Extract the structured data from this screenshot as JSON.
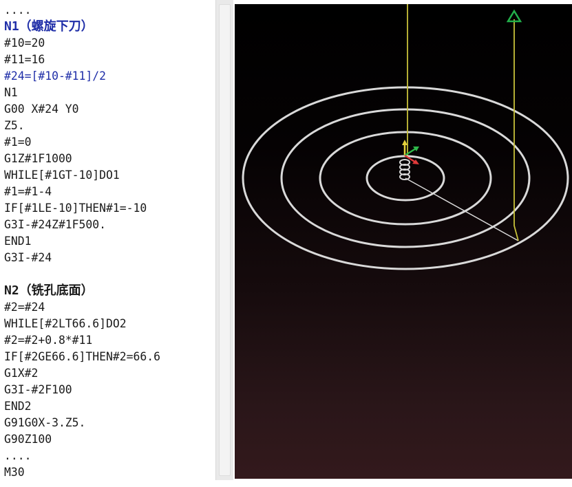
{
  "editor": {
    "lines": [
      {
        "text": "....",
        "style": "code"
      },
      {
        "text": "N1（螺旋下刀）",
        "style": "comment"
      },
      {
        "text": "#10=20",
        "style": "code"
      },
      {
        "text": "#11=16",
        "style": "code"
      },
      {
        "text": "#24=[#10-#11]/2",
        "style": "code"
      },
      {
        "text": "N1",
        "style": "code"
      },
      {
        "text": "G00 X#24 Y0",
        "style": "code"
      },
      {
        "text": "Z5.",
        "style": "code"
      },
      {
        "text": "#1=0",
        "style": "code"
      },
      {
        "text": "G1Z#1F1000",
        "style": "code"
      },
      {
        "text": "WHILE[#1GT-10]DO1",
        "style": "code"
      },
      {
        "text": "#1=#1-4",
        "style": "code"
      },
      {
        "text": "IF[#1LE-10]THEN#1=-10",
        "style": "code"
      },
      {
        "text": "G3I-#24Z#1F500.",
        "style": "code"
      },
      {
        "text": "END1",
        "style": "code"
      },
      {
        "text": "G3I-#24",
        "style": "code"
      },
      {
        "text": "",
        "style": "blank"
      },
      {
        "text": "N2（铣孔底面）",
        "style": "comment"
      },
      {
        "text": "#2=#24",
        "style": "code"
      },
      {
        "text": "WHILE[#2LT66.6]DO2",
        "style": "code"
      },
      {
        "text": "#2=#2+0.8*#11",
        "style": "code"
      },
      {
        "text": "IF[#2GE66.6]THEN#2=66.6",
        "style": "code"
      },
      {
        "text": "G1X#2",
        "style": "code"
      },
      {
        "text": "G3I-#2F100",
        "style": "code"
      },
      {
        "text": "END2",
        "style": "code"
      },
      {
        "text": "G91G0X-3.Z5.",
        "style": "code"
      },
      {
        "text": "G90Z100",
        "style": "code"
      },
      {
        "text": "....",
        "style": "code"
      },
      {
        "text": "M30",
        "style": "code"
      }
    ]
  },
  "viewport": {
    "colors": {
      "circle": "#d9d9d9",
      "rapid_path": "#c8c23a",
      "marker": "#22b04a",
      "axis_x": "#e03a3a",
      "axis_y": "#2fb84a",
      "axis_z": "#e6d23a"
    },
    "icons": [
      "start-triangle-icon",
      "axis-gizmo-icon"
    ]
  }
}
